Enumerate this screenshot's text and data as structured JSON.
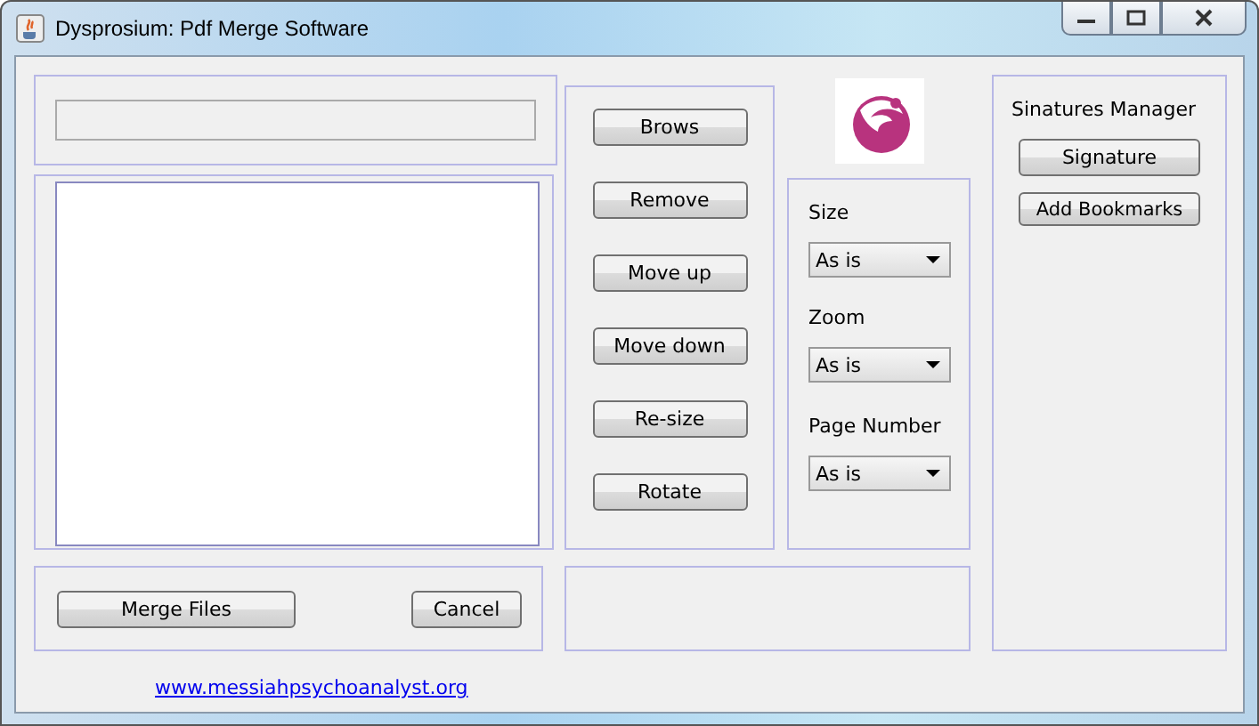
{
  "window": {
    "title": "Dysprosium: Pdf Merge Software"
  },
  "actions": [
    "Brows",
    "Remove",
    "Move up",
    "Move down",
    "Re-size",
    "Rotate"
  ],
  "options": [
    {
      "label": "Size",
      "value": "As is"
    },
    {
      "label": "Zoom",
      "value": "As is"
    },
    {
      "label": "Page Number",
      "value": "As is"
    }
  ],
  "signatures": {
    "title": "Sinatures Manager",
    "buttons": [
      "Signature",
      "Add Bookmarks"
    ]
  },
  "merge_button": "Merge Files",
  "cancel_button": "Cancel",
  "link": "www.messiahpsychoanalyst.org"
}
